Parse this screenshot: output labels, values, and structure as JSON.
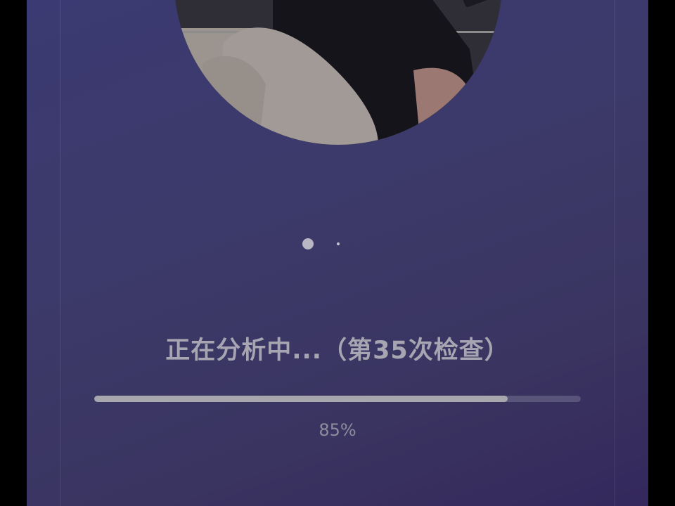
{
  "status": {
    "analysis_text": "正在分析中...（第35次检查）"
  },
  "progress": {
    "value": 0.85,
    "label": "85%"
  },
  "carousel": {
    "dot_count": 2,
    "active_index": 0
  },
  "colors": {
    "background_gradient_start": "#3b3a72",
    "background_gradient_end": "#34285c",
    "progress_fill": "#a9a7ae",
    "text_primary": "#a7a5b2"
  },
  "icons": {
    "carousel_dot_active": "carousel-dot-active-icon",
    "carousel_dot_inactive": "carousel-dot-inactive-icon"
  }
}
